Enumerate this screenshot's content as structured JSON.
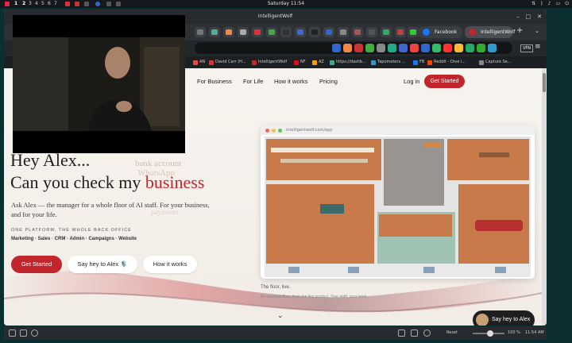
{
  "os": {
    "workspaces": [
      "1",
      "2",
      "3",
      "4",
      "5",
      "6",
      "7"
    ],
    "active_workspace": "2",
    "clock": "Saturday 11:54"
  },
  "browser": {
    "window_title": "IntelligentWolf",
    "tabs": [
      {
        "label": "Facebook",
        "color": "#1877f2"
      },
      {
        "label": "IntelligentWolf",
        "color": "#c0262b",
        "active": true
      }
    ],
    "new_tab": "+",
    "bookmarks": [
      {
        "label": "AN",
        "color": "#e44"
      },
      {
        "label": "David Carr (H...",
        "color": "#d33"
      },
      {
        "label": "IntelligentWolf",
        "color": "#c0262b"
      },
      {
        "label": "NF",
        "color": "#e50914"
      },
      {
        "label": "AZ",
        "color": "#f90"
      },
      {
        "label": "https://dashb...",
        "color": "#4a8"
      },
      {
        "label": "Tapometers ...",
        "color": "#39c"
      },
      {
        "label": "FB",
        "color": "#1877f2"
      },
      {
        "label": "Reddit - Dive i...",
        "color": "#ff4500"
      },
      {
        "label": "Capture Se...",
        "color": "#888"
      }
    ],
    "vpn_label": "VPN",
    "status": {
      "reset_label": "Reset",
      "zoom": "100 %",
      "time": "11:54 AM"
    }
  },
  "site": {
    "nav": {
      "for_business": "For Business",
      "for_life": "For Life",
      "how_it_works": "How it works",
      "pricing": "Pricing",
      "login": "Log in",
      "get_started": "Get Started"
    },
    "faint_words": [
      "bank account",
      "WhatsApp",
      "payments"
    ],
    "hero_line1": "Hey Alex...",
    "hero_line2_prefix": "Can you check my ",
    "hero_line2_accent": "business",
    "subtitle": "Ask Alex — the manager for a whole floor of AI staff. For your business, and for your life.",
    "kicker": "ONE PLATFORM, THE WHOLE BACK OFFICE",
    "features": "Marketing · Sales · CRM · Admin · Campaigns · Website",
    "btn_get_started": "Get Started",
    "btn_say_hey": "Say hey to Alex 🎙️",
    "btn_how": "How it works",
    "mock_url": "intelligentwolf.com/app",
    "caption": "The floor, live.",
    "caption_sub": "An example floor, from the live product. Your staff, your work.",
    "chevron": "⌄",
    "floating_btn": "Say hey to Alex"
  },
  "colors": {
    "accent": "#c0262b",
    "page_bg": "#f6f1ec",
    "floor_wood": "#c9794a",
    "floor_tile": "#8fb4a6"
  }
}
